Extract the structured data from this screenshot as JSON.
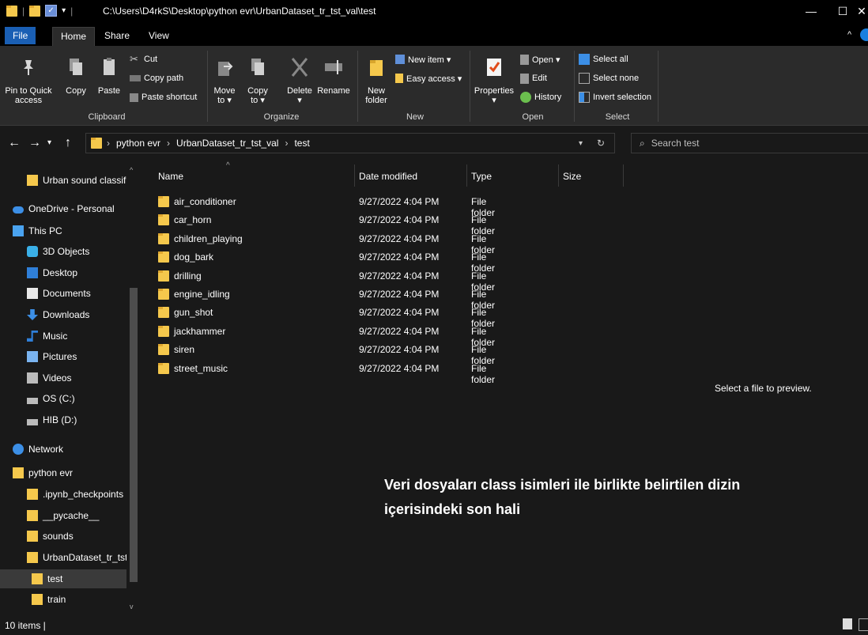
{
  "window": {
    "title_path": "C:\\Users\\D4rkS\\Desktop\\python evr\\UrbanDataset_tr_tst_val\\test",
    "minimize": "—",
    "maximize": "☐",
    "close": "✕"
  },
  "ribbon_tabs": [
    "File",
    "Home",
    "Share",
    "View"
  ],
  "ribbon": {
    "clipboard": {
      "pin_label_1": "Pin to Quick",
      "pin_label_2": "access",
      "copy": "Copy",
      "paste": "Paste",
      "cut": "Cut",
      "copy_path": "Copy path",
      "paste_shortcut": "Paste shortcut",
      "group": "Clipboard"
    },
    "organize": {
      "move_1": "Move",
      "move_2": "to ▾",
      "copy_1": "Copy",
      "copy_2": "to ▾",
      "delete_1": "Delete",
      "delete_2": "▾",
      "rename": "Rename",
      "group": "Organize"
    },
    "new": {
      "new_folder_1": "New",
      "new_folder_2": "folder",
      "new_item": "New item ▾",
      "easy_access": "Easy access ▾",
      "group": "New"
    },
    "open": {
      "properties_1": "Properties",
      "properties_2": "▾",
      "open": "Open ▾",
      "edit": "Edit",
      "history": "History",
      "group": "Open"
    },
    "select": {
      "select_all": "Select all",
      "select_none": "Select none",
      "invert": "Invert selection",
      "group": "Select"
    }
  },
  "address": {
    "crumbs": [
      "python evr",
      "UrbanDataset_tr_tst_val",
      "test"
    ],
    "search_placeholder": "Search test"
  },
  "nav": [
    {
      "label": "Urban sound classifi",
      "icon": "folder-icon",
      "level": "sub"
    },
    {
      "label": "OneDrive - Personal",
      "icon": "cloud-icon",
      "level": "top"
    },
    {
      "label": "This PC",
      "icon": "pc-icon",
      "level": "top"
    },
    {
      "label": "3D Objects",
      "icon": "3d-objects-icon",
      "level": "sub"
    },
    {
      "label": "Desktop",
      "icon": "desktop-icon",
      "level": "sub"
    },
    {
      "label": "Documents",
      "icon": "documents-icon",
      "level": "sub"
    },
    {
      "label": "Downloads",
      "icon": "downloads-icon",
      "level": "sub"
    },
    {
      "label": "Music",
      "icon": "music-icon",
      "level": "sub"
    },
    {
      "label": "Pictures",
      "icon": "pictures-icon",
      "level": "sub"
    },
    {
      "label": "Videos",
      "icon": "videos-icon",
      "level": "sub"
    },
    {
      "label": "OS (C:)",
      "icon": "drive-c-icon",
      "level": "sub"
    },
    {
      "label": "HIB (D:)",
      "icon": "drive-d-icon",
      "level": "sub"
    },
    {
      "label": "Network",
      "icon": "network-icon",
      "level": "top"
    },
    {
      "label": "python evr",
      "icon": "folder-icon",
      "level": "top"
    },
    {
      "label": ".ipynb_checkpoints",
      "icon": "folder-icon",
      "level": "sub"
    },
    {
      "label": "__pycache__",
      "icon": "folder-icon",
      "level": "sub"
    },
    {
      "label": "sounds",
      "icon": "folder-icon",
      "level": "sub"
    },
    {
      "label": "UrbanDataset_tr_tst_",
      "icon": "folder-icon",
      "level": "sub"
    },
    {
      "label": "test",
      "icon": "folder-icon",
      "level": "sub2",
      "selected": true
    },
    {
      "label": "train",
      "icon": "folder-icon",
      "level": "sub2"
    }
  ],
  "columns": {
    "name": "Name",
    "date": "Date modified",
    "type": "Type",
    "size": "Size"
  },
  "files": [
    {
      "name": "air_conditioner",
      "date": "9/27/2022 4:04 PM",
      "type": "File folder"
    },
    {
      "name": "car_horn",
      "date": "9/27/2022 4:04 PM",
      "type": "File folder"
    },
    {
      "name": "children_playing",
      "date": "9/27/2022 4:04 PM",
      "type": "File folder"
    },
    {
      "name": "dog_bark",
      "date": "9/27/2022 4:04 PM",
      "type": "File folder"
    },
    {
      "name": "drilling",
      "date": "9/27/2022 4:04 PM",
      "type": "File folder"
    },
    {
      "name": "engine_idling",
      "date": "9/27/2022 4:04 PM",
      "type": "File folder"
    },
    {
      "name": "gun_shot",
      "date": "9/27/2022 4:04 PM",
      "type": "File folder"
    },
    {
      "name": "jackhammer",
      "date": "9/27/2022 4:04 PM",
      "type": "File folder"
    },
    {
      "name": "siren",
      "date": "9/27/2022 4:04 PM",
      "type": "File folder"
    },
    {
      "name": "street_music",
      "date": "9/27/2022 4:04 PM",
      "type": "File folder"
    }
  ],
  "preview_text": "Select a file to preview.",
  "annotation": {
    "line1": "Veri dosyaları class isimleri ile birlikte belirtilen dizin",
    "line2": "içerisindeki son hali"
  },
  "status": "10 items  |",
  "colors": {
    "accent": "#1a5fb4",
    "folder": "#f5c84c",
    "background": "#191919"
  }
}
